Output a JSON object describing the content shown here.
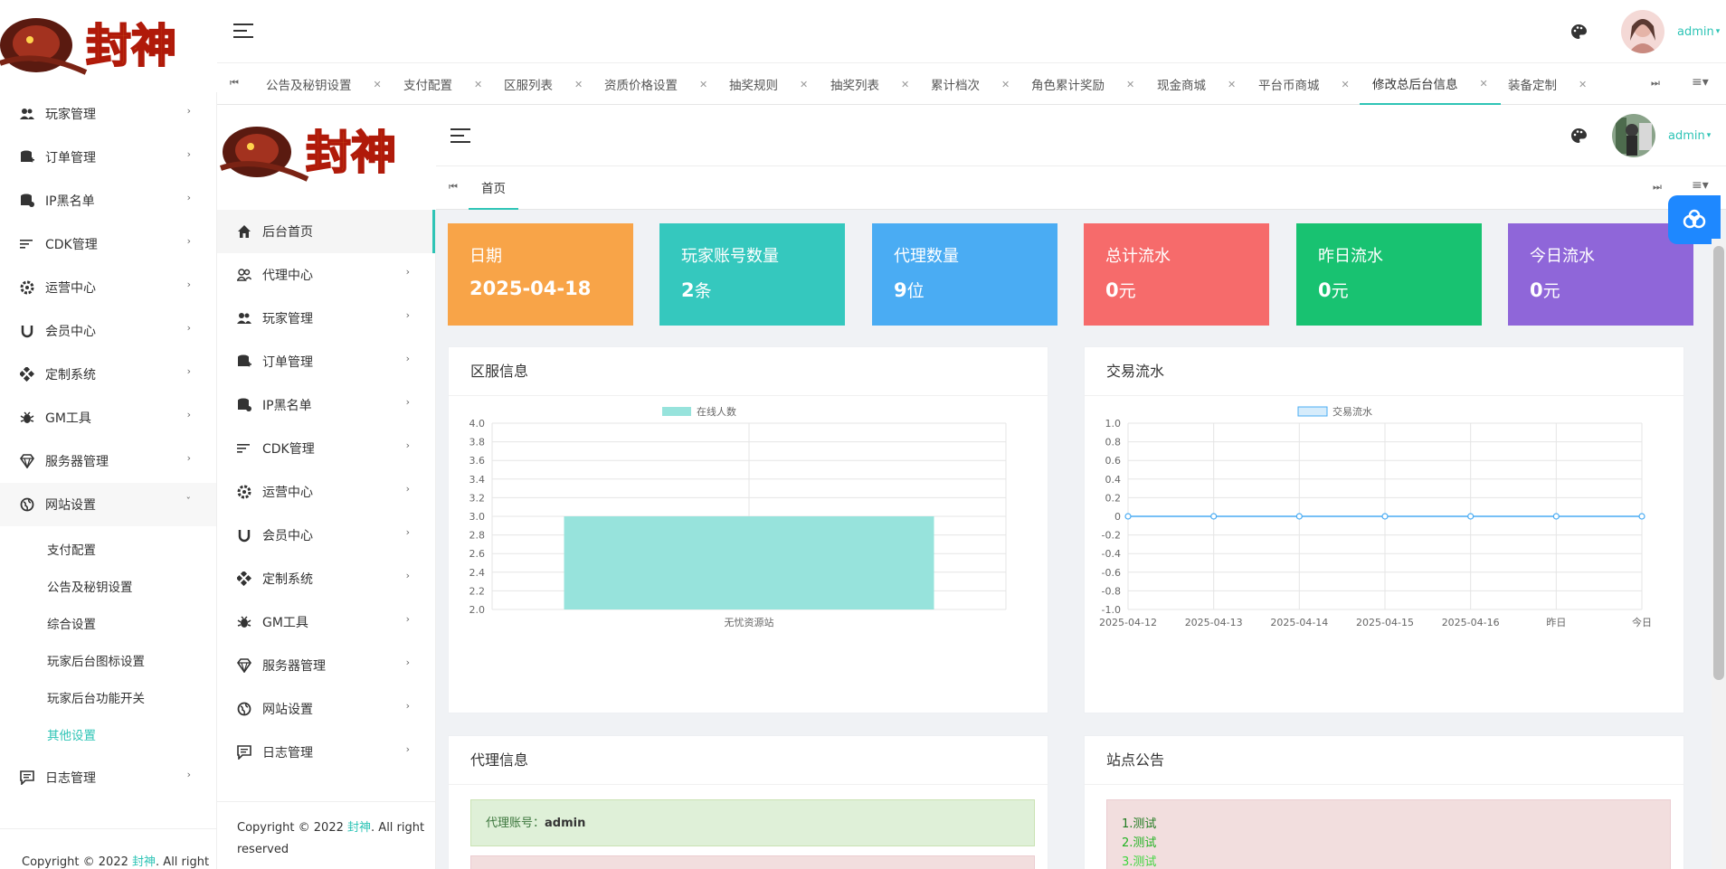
{
  "brand": {
    "name": "封神"
  },
  "outer": {
    "user": "admin",
    "sidebar": [
      {
        "label": "玩家管理",
        "icon": "users-icon"
      },
      {
        "label": "订单管理",
        "icon": "database-plus-icon"
      },
      {
        "label": "IP黑名单",
        "icon": "database-lock-icon"
      },
      {
        "label": "CDK管理",
        "icon": "list-icon"
      },
      {
        "label": "运营中心",
        "icon": "gear-icon"
      },
      {
        "label": "会员中心",
        "icon": "magnet-icon"
      },
      {
        "label": "定制系统",
        "icon": "diamond-grid-icon"
      },
      {
        "label": "GM工具",
        "icon": "bug-icon"
      },
      {
        "label": "服务器管理",
        "icon": "gem-icon"
      },
      {
        "label": "网站设置",
        "icon": "globe-icon"
      }
    ],
    "submenu": [
      "支付配置",
      "公告及秘钥设置",
      "综合设置",
      "玩家后台图标设置",
      "玩家后台功能开关",
      "其他设置"
    ],
    "sidebar_last": {
      "label": "日志管理",
      "icon": "message-icon"
    },
    "copyright": {
      "prefix": "Copyright © 2022 ",
      "brand": "封神",
      "suffix": ". All right"
    },
    "tabs": [
      "公告及秘钥设置",
      "支付配置",
      "区服列表",
      "资质价格设置",
      "抽奖规则",
      "抽奖列表",
      "累计档次",
      "角色累计奖励",
      "现金商城",
      "平台币商城",
      "修改总后台信息",
      "装备定制"
    ]
  },
  "inner": {
    "user": "admin",
    "sidebar": [
      {
        "label": "后台首页",
        "icon": "home-icon"
      },
      {
        "label": "代理中心",
        "icon": "agent-icon"
      },
      {
        "label": "玩家管理",
        "icon": "users-icon"
      },
      {
        "label": "订单管理",
        "icon": "database-plus-icon"
      },
      {
        "label": "IP黑名单",
        "icon": "database-lock-icon"
      },
      {
        "label": "CDK管理",
        "icon": "list-icon"
      },
      {
        "label": "运营中心",
        "icon": "gear-icon"
      },
      {
        "label": "会员中心",
        "icon": "magnet-icon"
      },
      {
        "label": "定制系统",
        "icon": "diamond-grid-icon"
      },
      {
        "label": "GM工具",
        "icon": "bug-icon"
      },
      {
        "label": "服务器管理",
        "icon": "gem-icon"
      },
      {
        "label": "网站设置",
        "icon": "globe-icon"
      },
      {
        "label": "日志管理",
        "icon": "message-icon"
      }
    ],
    "copyright": {
      "prefix": "Copyright © 2022 ",
      "brand": "封神",
      "suffix": ". All right",
      "line2": "reserved"
    },
    "tab": "首页",
    "cards": [
      {
        "label": "日期",
        "value": "2025-04-18",
        "unit": "",
        "color": "#f8a448"
      },
      {
        "label": "玩家账号数量",
        "value": "2",
        "unit": "条",
        "color": "#35c8be"
      },
      {
        "label": "代理数量",
        "value": "9",
        "unit": "位",
        "color": "#4aacf3"
      },
      {
        "label": "总计流水",
        "value": "0",
        "unit": "元",
        "color": "#f66b6b"
      },
      {
        "label": "昨日流水",
        "value": "0",
        "unit": "元",
        "color": "#18c271"
      },
      {
        "label": "今日流水",
        "value": "0",
        "unit": "元",
        "color": "#8f66d9"
      }
    ],
    "panels": {
      "server": "区服信息",
      "trade": "交易流水",
      "agent": "代理信息",
      "notice": "站点公告"
    },
    "agent_info": {
      "label": "代理账号：",
      "value": "admin"
    },
    "notices": [
      "1.测试",
      "2.测试",
      "3.测试"
    ]
  },
  "chart_data": [
    {
      "type": "bar",
      "legend": "在线人数",
      "categories": [
        "无忧资源站"
      ],
      "values": [
        3
      ],
      "ylim": [
        2.0,
        4.0
      ],
      "yticks": [
        "4.0",
        "3.8",
        "3.6",
        "3.4",
        "3.2",
        "3.0",
        "2.8",
        "2.6",
        "2.4",
        "2.2",
        "2.0"
      ],
      "color": "#97e3dc"
    },
    {
      "type": "line",
      "legend": "交易流水",
      "categories": [
        "2025-04-12",
        "2025-04-13",
        "2025-04-14",
        "2025-04-15",
        "2025-04-16",
        "昨日",
        "今日"
      ],
      "values": [
        0,
        0,
        0,
        0,
        0,
        0,
        0
      ],
      "ylim": [
        -1.0,
        1.0
      ],
      "yticks": [
        "1.0",
        "0.8",
        "0.6",
        "0.4",
        "0.2",
        "0",
        "-0.2",
        "-0.4",
        "-0.6",
        "-0.8",
        "-1.0"
      ],
      "color": "#4aacf3"
    }
  ]
}
